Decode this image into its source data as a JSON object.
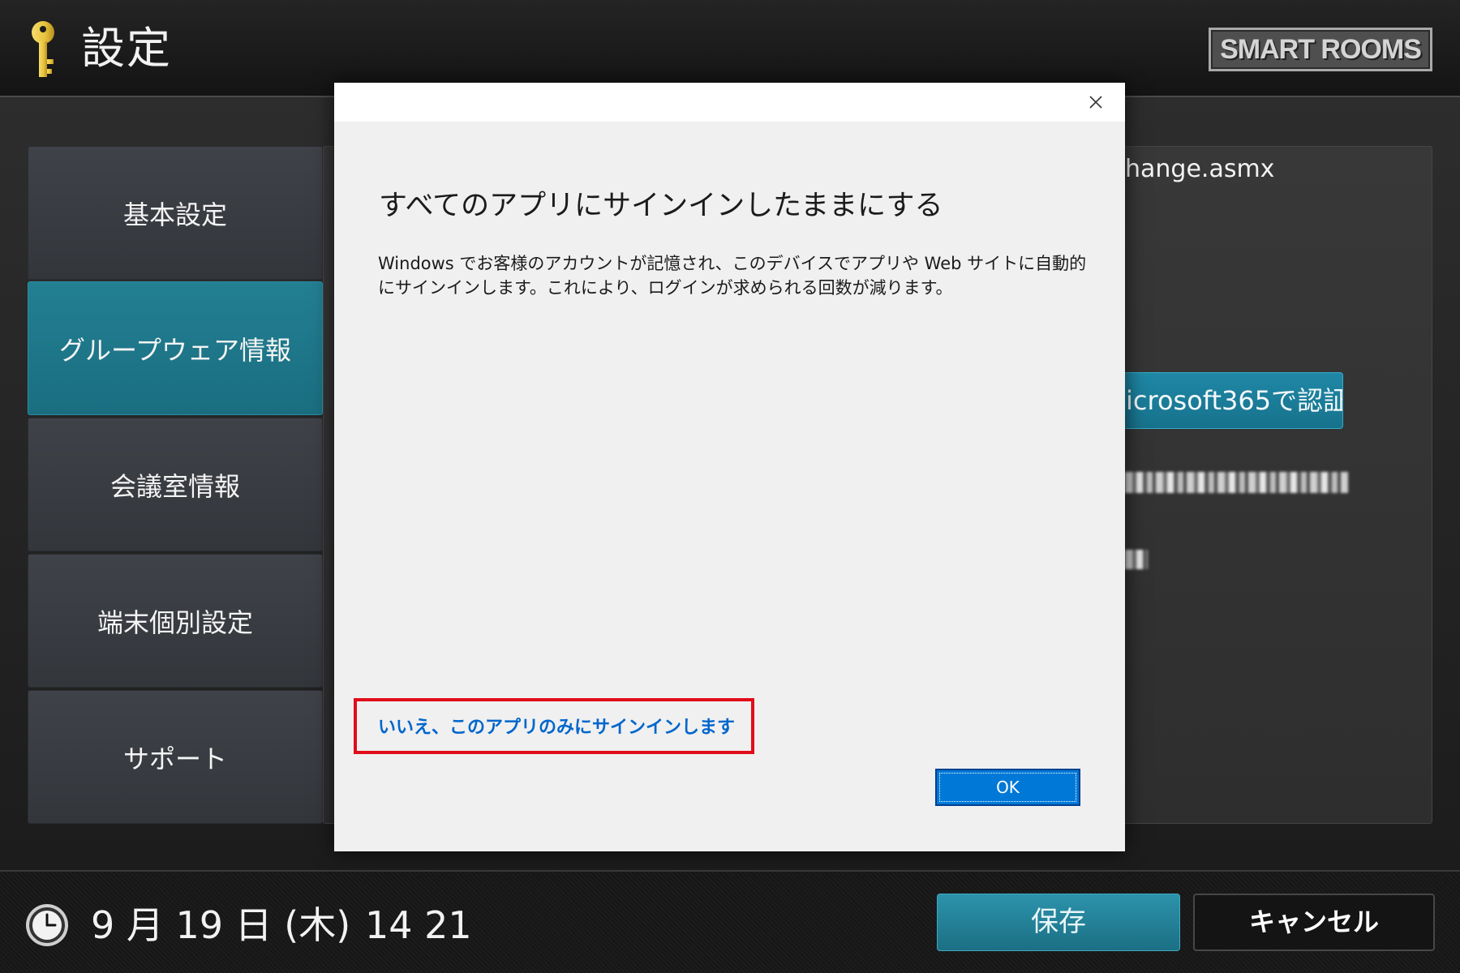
{
  "header": {
    "title": "設定",
    "logo_text": "SMART ROOMS",
    "icon": "key-icon"
  },
  "sidebar": {
    "items": [
      {
        "label": "基本設定",
        "active": false
      },
      {
        "label": "グループウェア情報",
        "active": true
      },
      {
        "label": "会議室情報",
        "active": false
      },
      {
        "label": "端末個別設定",
        "active": false
      },
      {
        "label": "サポート",
        "active": false
      }
    ]
  },
  "content": {
    "server_url_fragment": "hange.asmx",
    "auth_button_label": "icrosoft365で認証"
  },
  "dialog": {
    "close_icon": "close-icon",
    "heading": "すべてのアプリにサインインしたままにする",
    "body": "Windows でお客様のアカウントが記憶され、このデバイスでアプリや Web サイトに自動的にサインインします。これにより、ログインが求められる回数が減ります。",
    "link_label": "いいえ、このアプリのみにサインインします",
    "ok_label": "OK"
  },
  "footer": {
    "icon": "clock-icon",
    "date": "9 月 19 日 (木)",
    "time": "14 21",
    "save_label": "保存",
    "cancel_label": "キャンセル"
  },
  "colors": {
    "accent_teal": "#1e7c90",
    "dialog_link": "#0066cc",
    "ok_button": "#0078d7",
    "highlight_red": "#e00d1a",
    "key_gold": "#e6c23c"
  }
}
